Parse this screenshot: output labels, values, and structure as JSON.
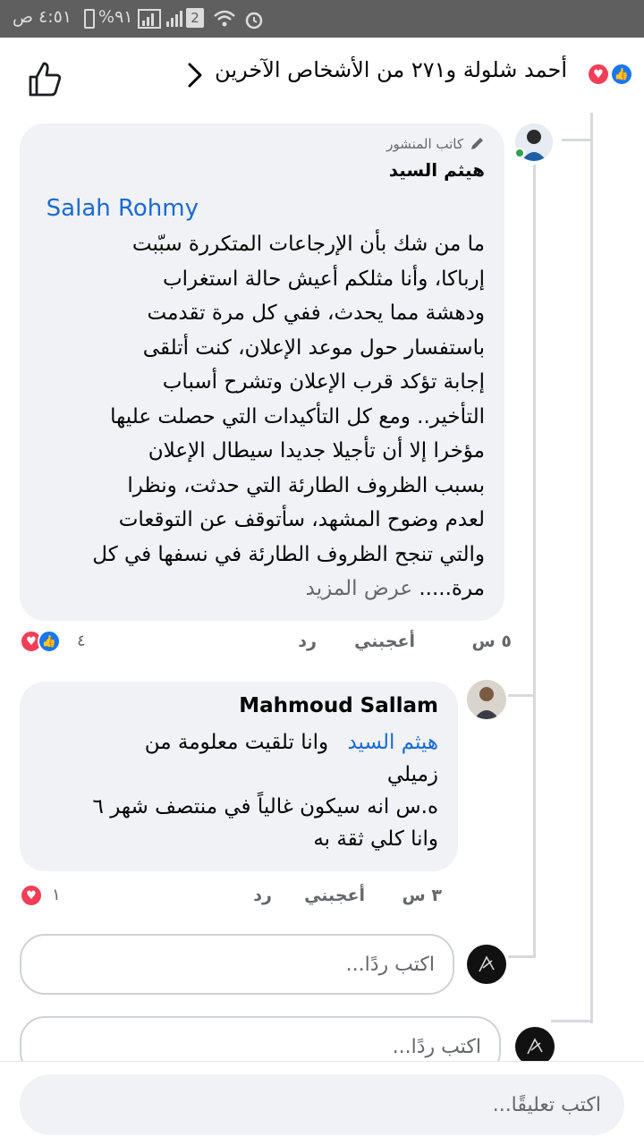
{
  "status_bar": {
    "time": "٤:٥١ ص",
    "battery": "%٩١",
    "sim_badge": "2"
  },
  "header": {
    "title": "أحمد شلولة و٢٧١ من الأشخاص الآخرين"
  },
  "comments": [
    {
      "author_label": "كاتب المنشور",
      "author": "هيثم السيد",
      "mention": "Salah Rohmy",
      "body_lines": [
        "ما من شك بأن الإرجاعات المتكررة سبّبت",
        "إرباكا، وأنا مثلكم أعيش حالة استغراب",
        "ودهشة مما يحدث، ففي كل مرة تقدمت",
        "باستفسار حول موعد الإعلان، كنت أتلقى",
        "إجابة تؤكد قرب الإعلان وتشرح أسباب",
        "التأخير.. ومع كل التأكيدات التي حصلت عليها",
        "مؤخرا  إلا أن تأجيلا  جديدا سيطال الإعلان",
        "بسبب الظروف الطارئة التي حدثت، ونظرا",
        "لعدم وضوح المشهد، سأتوقف عن التوقعات",
        "والتي تنجح الظروف الطارئة في نسفها في كل"
      ],
      "last_line": "مرة.....",
      "see_more": "عرض المزيد",
      "time": "٥ س",
      "like_label": "أعجبني",
      "reply_label": "رد",
      "reaction_count": "٤"
    },
    {
      "author": "Mahmoud Sallam",
      "mention": "هيثم السيد",
      "first_line_rest": "وانا تلقيت معلومة من",
      "body_lines": [
        "زميلي",
        "ه.س انه سيكون غالياً في منتصف شهر ٦",
        "وانا كلي ثقة به"
      ],
      "time": "٣ س",
      "like_label": "أعجبني",
      "reply_label": "رد",
      "reaction_count": "١"
    }
  ],
  "reply_placeholder": "اكتب ردًا...",
  "comment_placeholder": "اكتب تعليقًا...",
  "colors": {
    "like_blue": "#1877f2",
    "love_red": "#f33e58",
    "mention_blue": "#1b6ad0",
    "bubble_bg": "#f0f2f5"
  }
}
